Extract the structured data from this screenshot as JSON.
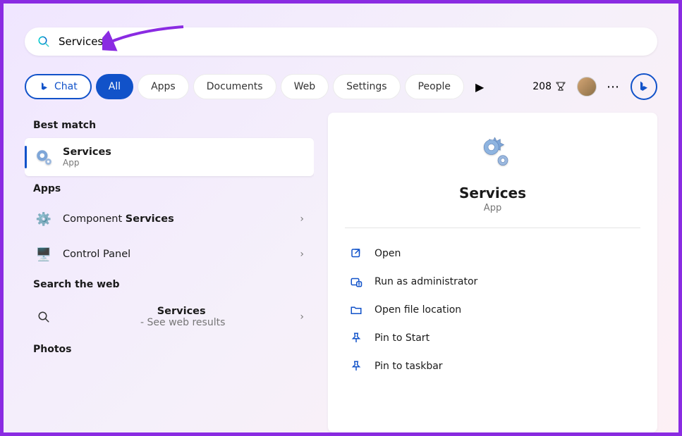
{
  "search": {
    "value": "Services"
  },
  "filters": {
    "chat": "Chat",
    "all": "All",
    "items": [
      "Apps",
      "Documents",
      "Web",
      "Settings",
      "People"
    ]
  },
  "rewards_points": "208",
  "left": {
    "best_match_header": "Best match",
    "best_match": {
      "title": "Services",
      "sub": "App"
    },
    "apps_header": "Apps",
    "apps": [
      {
        "prefix": "Component ",
        "bold": "Services"
      },
      {
        "prefix": "Control Panel",
        "bold": ""
      }
    ],
    "web_header": "Search the web",
    "web": {
      "term": "Services",
      "suffix": " - See web results"
    },
    "photos_header": "Photos"
  },
  "detail": {
    "title": "Services",
    "sub": "App",
    "actions": [
      {
        "icon": "open",
        "label": "Open"
      },
      {
        "icon": "admin",
        "label": "Run as administrator"
      },
      {
        "icon": "folder",
        "label": "Open file location"
      },
      {
        "icon": "pin",
        "label": "Pin to Start"
      },
      {
        "icon": "pin",
        "label": "Pin to taskbar"
      }
    ]
  }
}
